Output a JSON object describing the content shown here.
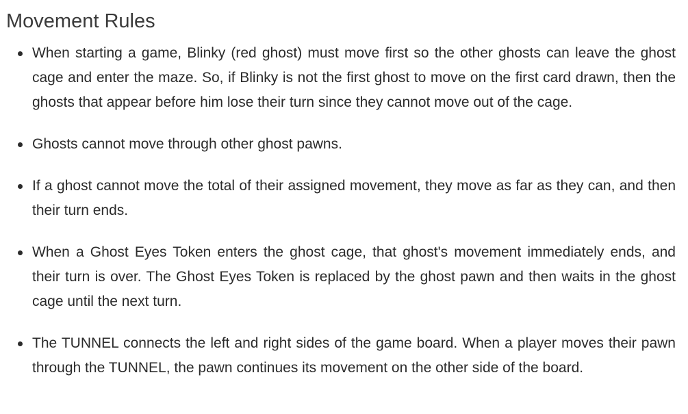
{
  "page": {
    "heading": "Movement Rules"
  },
  "rules": [
    {
      "text": "When starting a game, Blinky (red ghost) must move first so the other ghosts can leave the ghost cage and enter the maze. So, if Blinky is not the first ghost to move on the first card drawn, then the ghosts that appear before him lose their turn since they cannot move out of the cage."
    },
    {
      "text": "Ghosts cannot move through other ghost pawns."
    },
    {
      "text": "If a ghost cannot move the total of their assigned movement, they move as far as they can, and then their turn ends."
    },
    {
      "text": "When a Ghost Eyes Token enters the ghost cage, that ghost's movement immediately ends, and their turn is over. The Ghost Eyes Token is replaced by the ghost pawn and then waits in the ghost cage until the next turn."
    },
    {
      "text": "The TUNNEL connects the left and right sides of the game board. When a player moves their pawn through the TUNNEL, the pawn continues its movement on the other side of the board."
    }
  ]
}
